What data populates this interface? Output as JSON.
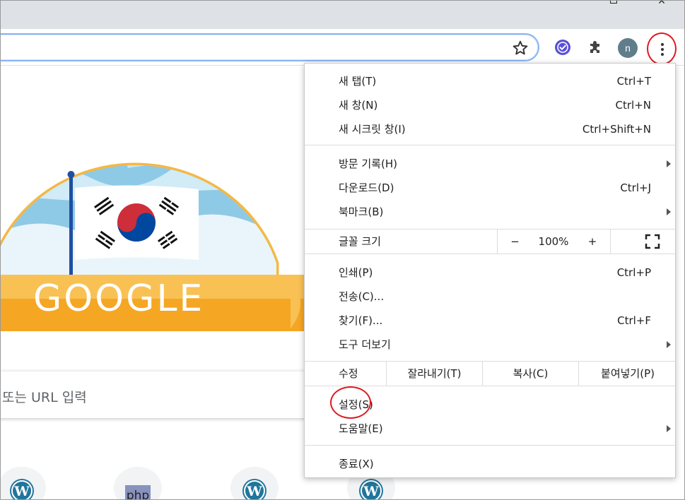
{
  "window": {
    "maximize_glyph": "",
    "close_glyph": "×"
  },
  "toolbar": {
    "profile_initial": "n",
    "icons": [
      "star-icon",
      "check-extension-icon",
      "puzzle-extension-icon",
      "more-vert-icon"
    ],
    "accent": "#e0191f"
  },
  "page": {
    "doodle_text": "GOOGLE",
    "search_placeholder": "또는 URL 입력"
  },
  "menu": {
    "new_tab": {
      "label": "새 탭(T)",
      "shortcut": "Ctrl+T"
    },
    "new_window": {
      "label": "새 창(N)",
      "shortcut": "Ctrl+N"
    },
    "incognito": {
      "label": "새 시크릿 창(I)",
      "shortcut": "Ctrl+Shift+N"
    },
    "history": {
      "label": "방문 기록(H)"
    },
    "downloads": {
      "label": "다운로드(D)",
      "shortcut": "Ctrl+J"
    },
    "bookmarks": {
      "label": "북마크(B)"
    },
    "zoom": {
      "label": "글꼴 크기",
      "minus": "−",
      "value": "100%",
      "plus": "+"
    },
    "print": {
      "label": "인쇄(P)",
      "shortcut": "Ctrl+P"
    },
    "cast": {
      "label": "전송(C)..."
    },
    "find": {
      "label": "찾기(F)...",
      "shortcut": "Ctrl+F"
    },
    "more_tools": {
      "label": "도구 더보기"
    },
    "edit": {
      "label": "수정",
      "cut": "잘라내기(T)",
      "copy": "복사(C)",
      "paste": "붙여넣기(P)"
    },
    "settings": {
      "label": "설정(S)"
    },
    "help": {
      "label": "도움말(E)"
    },
    "exit": {
      "label": "종료(X)"
    }
  },
  "colors": {
    "sky": "#8ecae6",
    "arch_border": "#f5b843",
    "banner": "#f5a623",
    "flag_red": "#cd2e3a",
    "flag_blue": "#0047a0"
  }
}
